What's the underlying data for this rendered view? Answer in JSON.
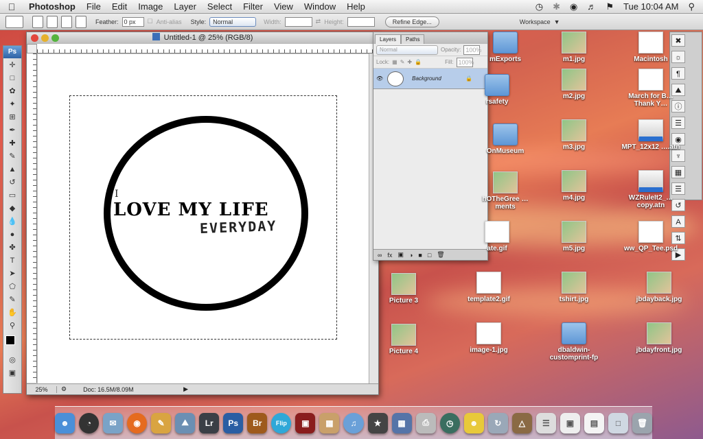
{
  "menubar": {
    "app": "Photoshop",
    "items": [
      "File",
      "Edit",
      "Image",
      "Layer",
      "Select",
      "Filter",
      "View",
      "Window",
      "Help"
    ],
    "clock": "Tue 10:04 AM"
  },
  "options": {
    "feather_label": "Feather:",
    "feather_value": "0 px",
    "antialias": "Anti-alias",
    "style_label": "Style:",
    "style_value": "Normal",
    "width_label": "Width:",
    "height_label": "Height:",
    "refine_edge": "Refine Edge...",
    "workspace": "Workspace"
  },
  "toolbox": {
    "badge": "Ps"
  },
  "document": {
    "title": "Untitled-1 @ 25% (RGB/8)",
    "zoom": "25%",
    "doc_size": "Doc: 16.5M/8.09M",
    "artwork": {
      "small_text": "I",
      "line1": "LOVE MY LIFE",
      "line2": "EVERYDAY"
    }
  },
  "layers_panel": {
    "tabs": [
      "Layers",
      "Paths"
    ],
    "blend_mode": "Normal",
    "opacity_label": "Opacity:",
    "opacity_value": "100%",
    "lock_label": "Lock:",
    "fill_label": "Fill:",
    "fill_value": "100%",
    "layer_name": "Background"
  },
  "desktop_icons": [
    {
      "label": "mExports",
      "kind": "folder"
    },
    {
      "label": "m1.jpg",
      "kind": "photo"
    },
    {
      "label": "Macintosh",
      "kind": "doc"
    },
    {
      "label": "rsafety",
      "kind": "folder"
    },
    {
      "label": "m2.jpg",
      "kind": "photo"
    },
    {
      "label": "March for B… Thank Y…",
      "kind": "doc"
    },
    {
      "label": "OnMuseum",
      "kind": "folder"
    },
    {
      "label": "m3.jpg",
      "kind": "photo"
    },
    {
      "label": "MPT_12x12 ….atn",
      "kind": "atn"
    },
    {
      "label": "hOTheGree …ments",
      "kind": "photo"
    },
    {
      "label": "m4.jpg",
      "kind": "photo"
    },
    {
      "label": "WZRuleIt2_… copy.atn",
      "kind": "atn"
    },
    {
      "label": "ate.gif",
      "kind": "doc"
    },
    {
      "label": "m5.jpg",
      "kind": "photo"
    },
    {
      "label": "ww_QP_Tee.psd",
      "kind": "doc"
    },
    {
      "label": "Picture 3",
      "kind": "photo"
    },
    {
      "label": "template2.gif",
      "kind": "doc"
    },
    {
      "label": "tshirt.jpg",
      "kind": "photo"
    },
    {
      "label": "jbdayback.jpg",
      "kind": "photo"
    },
    {
      "label": "Picture 4",
      "kind": "photo"
    },
    {
      "label": "image-1.jpg",
      "kind": "doc"
    },
    {
      "label": "dbaldwin-customprint-fp",
      "kind": "folder"
    },
    {
      "label": "jbdayfront.jpg",
      "kind": "photo"
    }
  ],
  "dock": {
    "items": [
      "Finder",
      "Dashboard",
      "Mail",
      "Firefox",
      "Pages",
      "iPhoto",
      "Lr",
      "Ps",
      "Br",
      "Flip",
      "PhotoBooth",
      "Preview",
      "iTunes",
      "iMovie",
      "Spaces",
      "Printer",
      "TimeMachine",
      "Adium",
      "iSync",
      "Keynote",
      "Stack",
      "Photos",
      "Docs",
      "Folder",
      "Trash"
    ]
  }
}
